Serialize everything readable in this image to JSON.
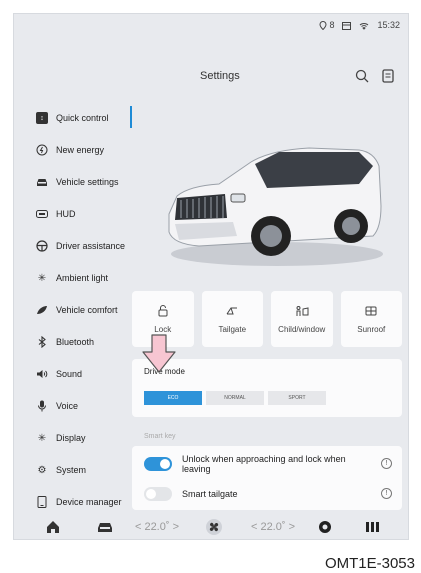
{
  "status": {
    "icons": [
      "gps-icon",
      "calendar-icon",
      "wifi-icon"
    ],
    "badge": "8",
    "time": "15:32"
  },
  "header": {
    "title": "Settings"
  },
  "sidebar": {
    "items": [
      {
        "label": "Quick control",
        "icon": "quick-control-icon",
        "active": true
      },
      {
        "label": "New energy",
        "icon": "energy-icon"
      },
      {
        "label": "Vehicle settings",
        "icon": "car-icon"
      },
      {
        "label": "HUD",
        "icon": "hud-icon"
      },
      {
        "label": "Driver assistance",
        "icon": "steering-wheel-icon"
      },
      {
        "label": "Ambient light",
        "icon": "light-icon"
      },
      {
        "label": "Vehicle comfort",
        "icon": "comfort-icon"
      },
      {
        "label": "Bluetooth",
        "icon": "bluetooth-icon"
      },
      {
        "label": "Sound",
        "icon": "speaker-icon"
      },
      {
        "label": "Voice",
        "icon": "microphone-icon"
      },
      {
        "label": "Display",
        "icon": "brightness-icon"
      },
      {
        "label": "System",
        "icon": "gear-icon"
      },
      {
        "label": "Device manager",
        "icon": "device-icon"
      }
    ]
  },
  "tiles": [
    {
      "label": "Lock",
      "icon": "lock-icon"
    },
    {
      "label": "Tailgate",
      "icon": "tailgate-icon"
    },
    {
      "label": "Child/window",
      "icon": "child-window-icon"
    },
    {
      "label": "Sunroof",
      "icon": "sunroof-icon"
    }
  ],
  "drive_mode": {
    "title": "Drive mode",
    "options": [
      "ECO",
      "NORMAL",
      "SPORT"
    ],
    "selected": "ECO"
  },
  "smart_key": {
    "section_label": "Smart key",
    "items": [
      {
        "label": "Unlock when approaching and lock when leaving",
        "enabled": true
      },
      {
        "label": "Smart tailgate",
        "enabled": false
      }
    ],
    "info_glyph": "!"
  },
  "bottom_bar": {
    "left_temp": "< 22.0˚ >",
    "right_temp": "< 22.0˚ >"
  },
  "caption": "OMT1E-3053",
  "colors": {
    "accent": "#2e93d9",
    "background": "#e8eaee",
    "card": "#fbfbfc",
    "arrow": "#f7c6d2"
  }
}
